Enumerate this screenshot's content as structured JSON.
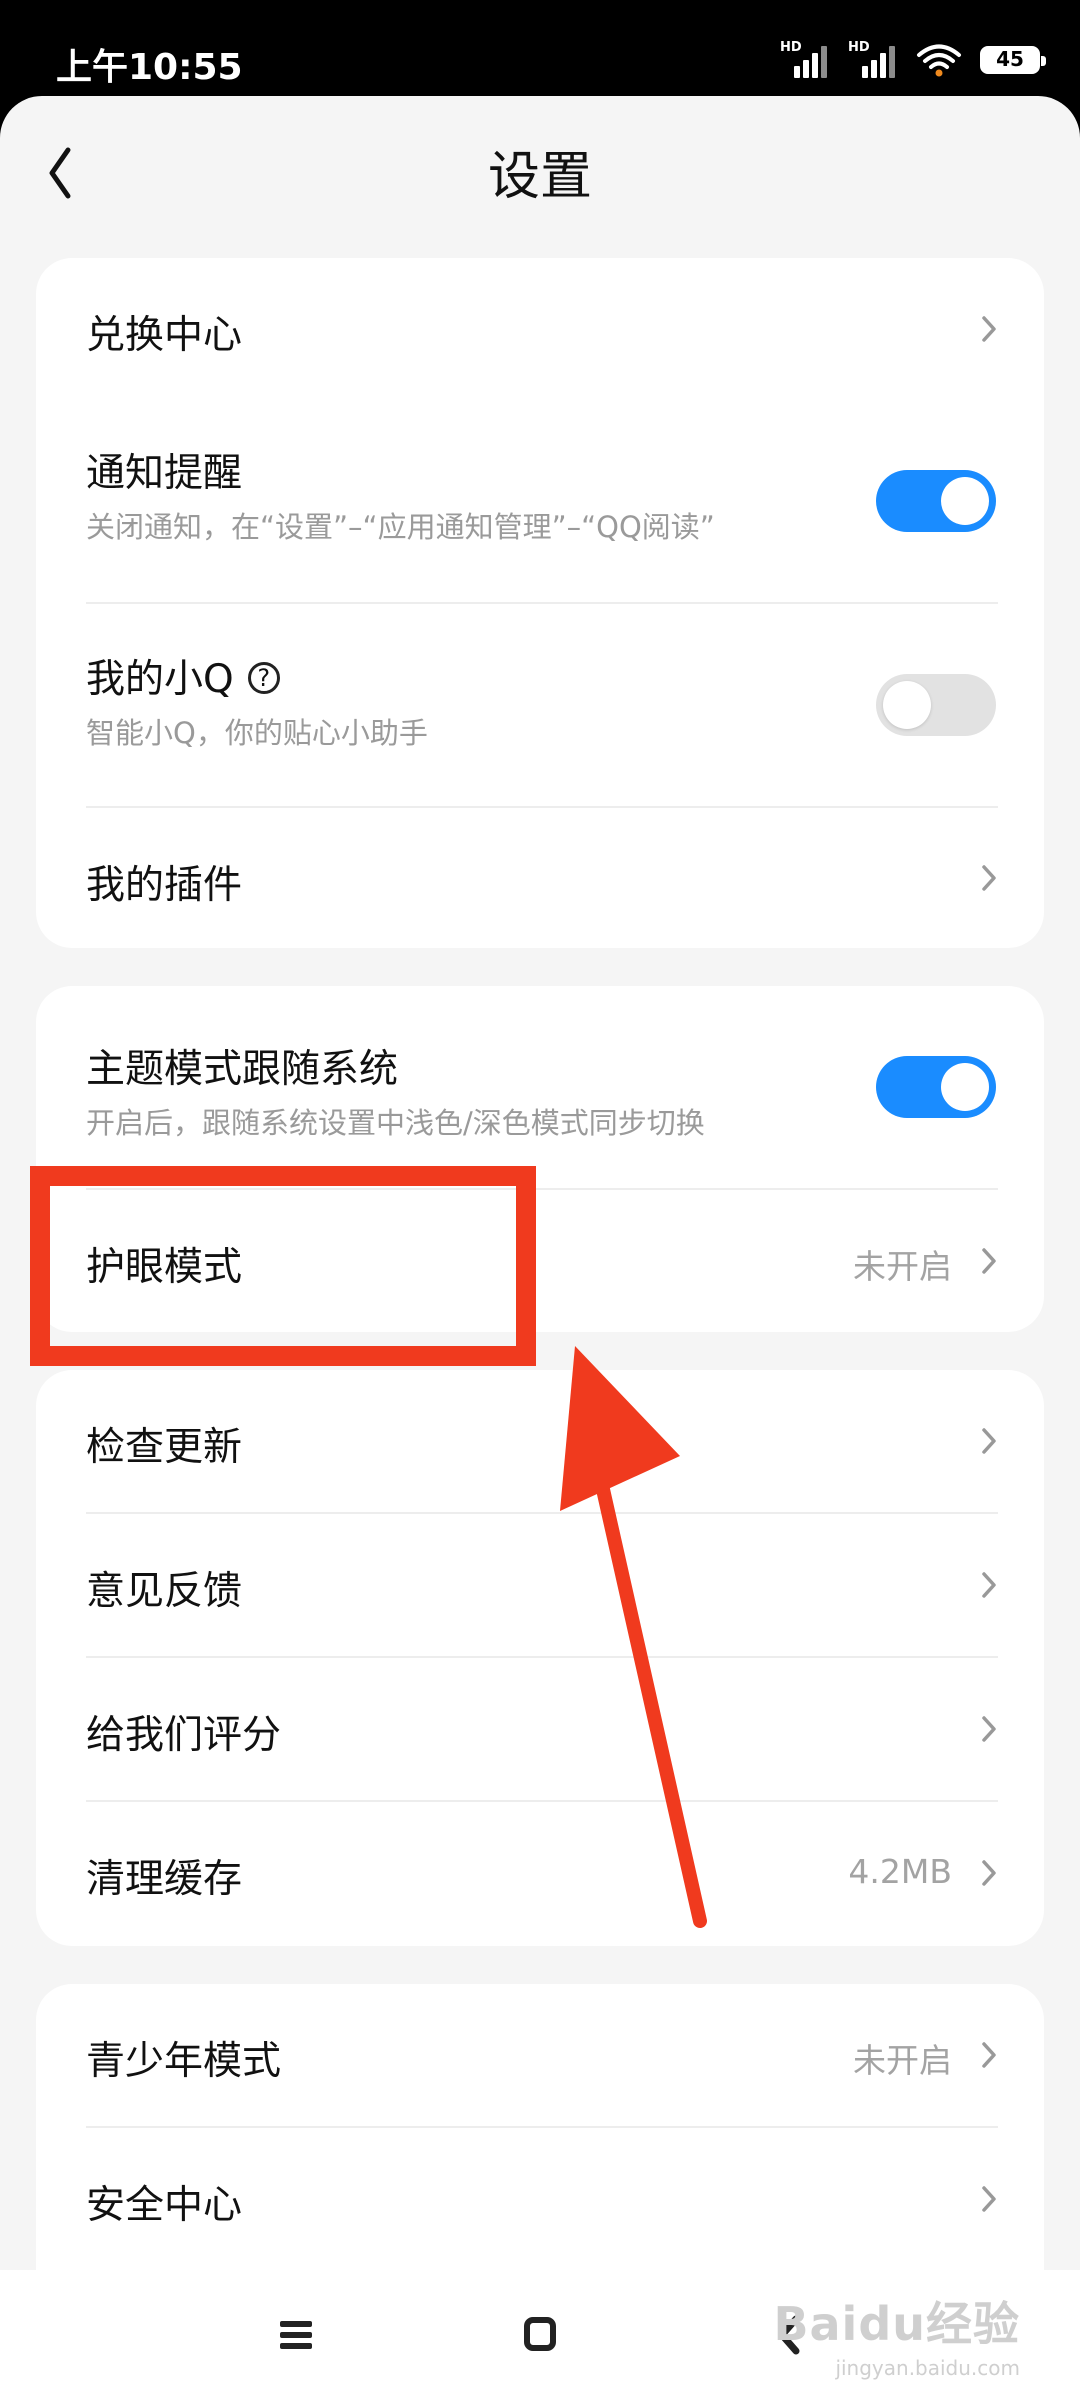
{
  "status_bar": {
    "time": "上午10:55",
    "hd1": "HD",
    "hd2": "HD",
    "battery": "45"
  },
  "header": {
    "title": "设置"
  },
  "card1": {
    "exchange_center": "兑换中心",
    "notification_title": "通知提醒",
    "notification_sub": "关闭通知，在“设置”–“应用通知管理”–“QQ阅读”",
    "notification_on": true,
    "my_q_title": "我的小Q",
    "my_q_sub": "智能小Q，你的贴心小助手",
    "my_q_on": false,
    "my_plugins": "我的插件"
  },
  "card2": {
    "theme_title": "主题模式跟随系统",
    "theme_sub": "开启后，跟随系统设置中浅色/深色模式同步切换",
    "theme_on": true,
    "eye_title": "护眼模式",
    "eye_value": "未开启"
  },
  "card3": {
    "check_update": "检查更新",
    "feedback": "意见反馈",
    "rate_us": "给我们评分",
    "clear_cache": "清理缓存",
    "cache_size": "4.2MB"
  },
  "card4": {
    "youth_mode": "青少年模式",
    "youth_value": "未开启",
    "security_center": "安全中心"
  },
  "colors": {
    "accent": "#1a8cff",
    "annotation": "#f03a1e"
  },
  "watermark": {
    "text": "Baidu经验",
    "url": "jingyan.baidu.com"
  }
}
